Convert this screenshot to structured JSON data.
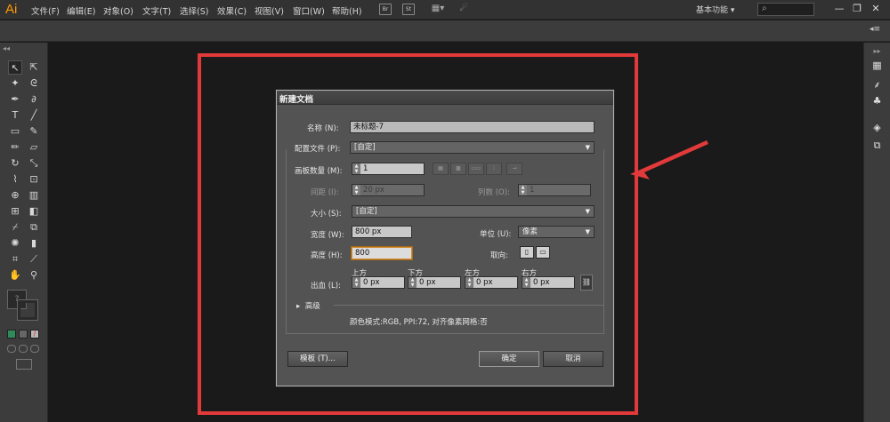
{
  "app": {
    "logo": "Ai"
  },
  "menu": [
    "文件(F)",
    "编辑(E)",
    "对象(O)",
    "文字(T)",
    "选择(S)",
    "效果(C)",
    "视图(V)",
    "窗口(W)",
    "帮助(H)"
  ],
  "menubar": {
    "br_icon": "Br",
    "st_icon": "St",
    "workspace": "基本功能 ▾",
    "search_glyph": "⌕",
    "minimize": "—",
    "restore": "❐",
    "close": "✕"
  },
  "dialog": {
    "title": "新建文档",
    "name_label": "名称 (N):",
    "name_value": "未标题-7",
    "profile_label": "配置文件 (P):",
    "profile_value": "[自定]",
    "artboards_label": "画板数量 (M):",
    "artboards_value": "1",
    "spacing_label": "间距 (I):",
    "spacing_value": "20 px",
    "columns_label": "列数 (O):",
    "columns_value": "1",
    "size_label": "大小 (S):",
    "size_value": "[自定]",
    "width_label": "宽度 (W):",
    "width_value": "800 px",
    "units_label": "单位 (U):",
    "units_value": "像素",
    "height_label": "高度 (H):",
    "height_value": "800",
    "orientation_label": "取向:",
    "bleed_label": "出血 (L):",
    "bleed_top_label": "上方",
    "bleed_bottom_label": "下方",
    "bleed_left_label": "左方",
    "bleed_right_label": "右方",
    "bleed_top": "0 px",
    "bleed_bottom": "0 px",
    "bleed_left": "0 px",
    "bleed_right": "0 px",
    "advanced_label": "高级",
    "info": "颜色模式:RGB, PPI:72, 对齐像素网格:否",
    "templates_button": "模板 (T)...",
    "ok_button": "确定",
    "cancel_button": "取消"
  },
  "colors": {
    "annotation": "#e23a3a",
    "accent": "#ff9a00"
  }
}
